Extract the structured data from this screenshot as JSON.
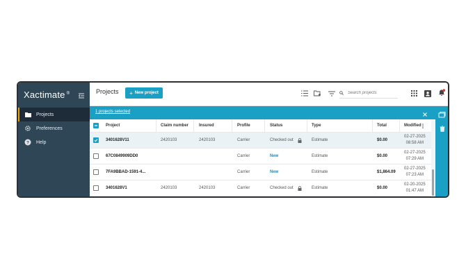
{
  "app": {
    "logo_text": "Xactimate",
    "logo_mark": "®"
  },
  "sidebar": {
    "items": [
      {
        "label": "Projects",
        "icon": "folder-icon",
        "active": true
      },
      {
        "label": "Preferences",
        "icon": "gear-icon",
        "active": false
      },
      {
        "label": "Help",
        "icon": "help-icon",
        "active": false
      }
    ]
  },
  "header": {
    "title": "Projects",
    "new_project_label": "New project",
    "search_placeholder": "Search projects"
  },
  "selection": {
    "text": "1 projects selected"
  },
  "table": {
    "columns": [
      "Project",
      "Claim number",
      "Insured",
      "Profile",
      "Status",
      "Type",
      "Total",
      "Modified"
    ],
    "rows": [
      {
        "project": "3401628V11",
        "claim": "2420103",
        "insured": "2420103",
        "profile": "Carrier",
        "status": "Checked out",
        "locked": true,
        "type": "Estimate",
        "total": "$0.00",
        "date": "02-27-2025",
        "time": "08:58 AM",
        "checked": true
      },
      {
        "project": "67C0849909DD0",
        "claim": "",
        "insured": "",
        "profile": "Carrier",
        "status": "New",
        "locked": false,
        "type": "Estimate",
        "total": "$0.00",
        "date": "02-27-2025",
        "time": "07:29 AM",
        "checked": false
      },
      {
        "project": "7FA9BBAD-1591-4...",
        "claim": "",
        "insured": "",
        "profile": "Carrier",
        "status": "New",
        "locked": false,
        "type": "Estimate",
        "total": "$1,864.09",
        "date": "02-27-2025",
        "time": "07:23 AM",
        "checked": false
      },
      {
        "project": "3401628V1",
        "claim": "2420103",
        "insured": "2420103",
        "profile": "Carrier",
        "status": "Checked out",
        "locked": true,
        "type": "Estimate",
        "total": "$0.00",
        "date": "02-20-2025",
        "time": "01:47 AM",
        "checked": false
      }
    ]
  },
  "colors": {
    "accent": "#1aa0c4",
    "sidebar": "#2f4657",
    "active_indicator": "#f0a500",
    "notification": "#e53935"
  }
}
